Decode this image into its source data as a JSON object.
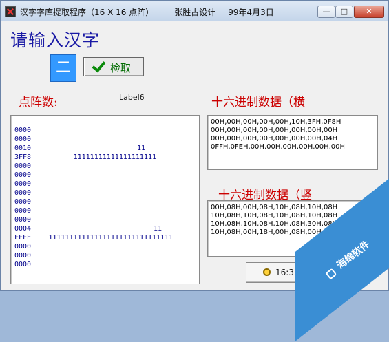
{
  "window": {
    "title": "汉字字库提取程序（16 X 16 点阵）_____张胜古设计___99年4月3日",
    "controls": {
      "minimize": "—",
      "maximize": "□",
      "close": "✕"
    }
  },
  "heading": "请输入汉字",
  "input_char": "二",
  "search_button": {
    "label": "检取",
    "icon": "check-icon"
  },
  "labels": {
    "dot_matrix": "点阵数:",
    "label6": "Label6",
    "hex_horizontal": "十六进制数据（横",
    "hex_vertical": "十六进制数据（竖"
  },
  "matrix_rows": [
    {
      "hex": "0000",
      "bits": ""
    },
    {
      "hex": "0000",
      "bits": ""
    },
    {
      "hex": "0010",
      "bits": "11"
    },
    {
      "hex": "3FF8",
      "bits": "11111111111111111111"
    },
    {
      "hex": "0000",
      "bits": ""
    },
    {
      "hex": "0000",
      "bits": ""
    },
    {
      "hex": "0000",
      "bits": ""
    },
    {
      "hex": "0000",
      "bits": ""
    },
    {
      "hex": "0000",
      "bits": ""
    },
    {
      "hex": "0000",
      "bits": ""
    },
    {
      "hex": "0000",
      "bits": ""
    },
    {
      "hex": "0004",
      "bits": "11"
    },
    {
      "hex": "FFFE",
      "bits": "111111111111111111111111111111"
    },
    {
      "hex": "0000",
      "bits": ""
    },
    {
      "hex": "0000",
      "bits": ""
    },
    {
      "hex": "0000",
      "bits": ""
    }
  ],
  "hex_horizontal": [
    "00H,00H,00H,00H,00H,10H,3FH,0F8H",
    "00H,00H,00H,00H,00H,00H,00H,00H",
    "00H,00H,00H,00H,00H,00H,00H,04H",
    "0FFH,0FEH,00H,00H,00H,00H,00H,00H"
  ],
  "hex_vertical": [
    "00H,08H,00H,08H,10H,08H,10H,08H",
    "10H,08H,10H,08H,10H,08H,10H,08H",
    "10H,08H,10H,08H,10H,08H,30H,08H",
    "10H,08H,00H,18H,00H,08H,00H,00H"
  ],
  "time": "16:31:",
  "watermark": "海绵软件"
}
